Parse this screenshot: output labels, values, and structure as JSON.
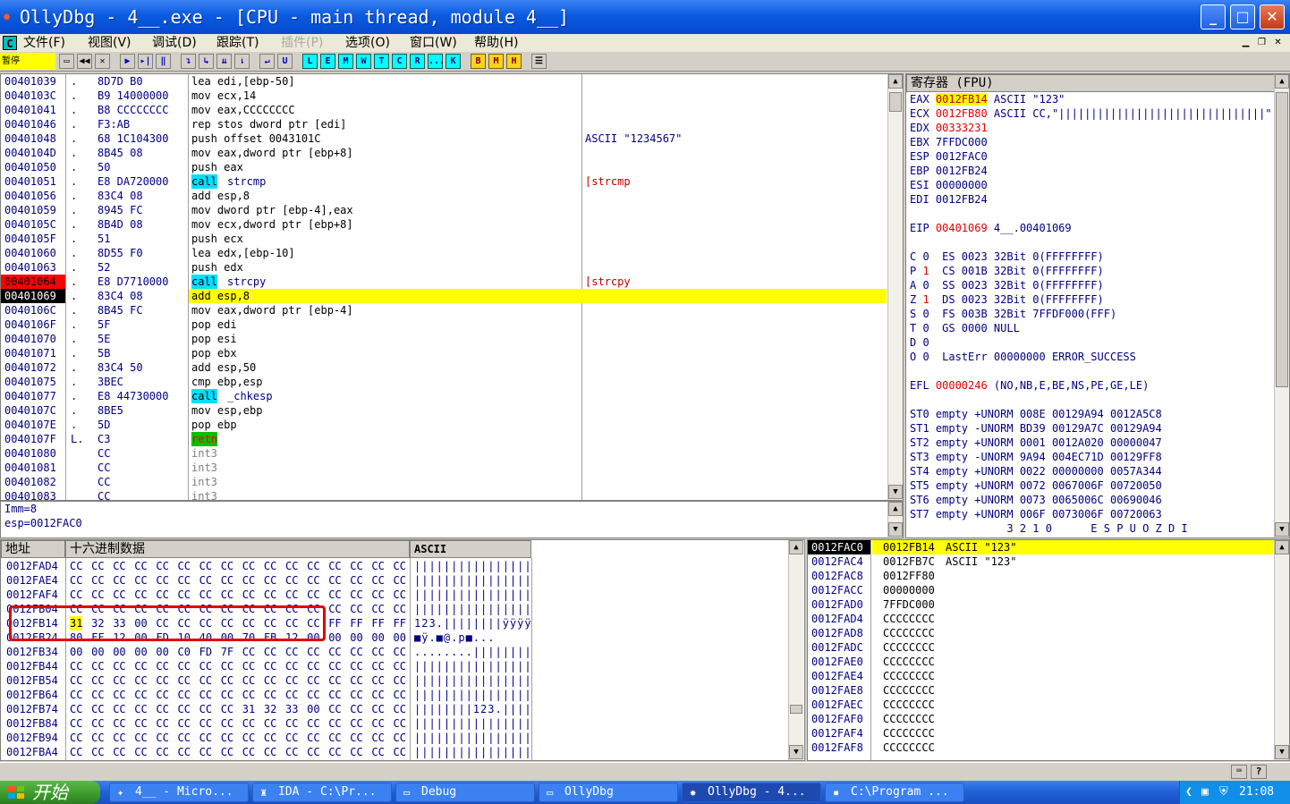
{
  "title": "OllyDbg - 4__.exe - [CPU - main thread, module 4__]",
  "window_buttons": {
    "minimize": "_",
    "maximize": "□",
    "close": "✕"
  },
  "menu": {
    "app_icon": "C",
    "items": [
      "文件(F)",
      "视图(V)",
      "调试(D)",
      "跟踪(T)",
      "插件(P)",
      "选项(O)",
      "窗口(W)",
      "帮助(H)"
    ],
    "disabled": [
      4
    ]
  },
  "status": "暂停",
  "toolbar": {
    "letters": [
      "L",
      "E",
      "M",
      "W",
      "T",
      "C",
      "R",
      "...",
      "K"
    ],
    "bmh": [
      "B",
      "M",
      "H"
    ]
  },
  "disasm": {
    "rows": [
      {
        "addr": "00401039",
        "mark": ".",
        "hex": "8D7D B0",
        "asm": "lea edi,[ebp-50]",
        "comment": ""
      },
      {
        "addr": "0040103C",
        "mark": ".",
        "hex": "B9 14000000",
        "asm": "mov ecx,14",
        "comment": ""
      },
      {
        "addr": "00401041",
        "mark": ".",
        "hex": "B8 CCCCCCCC",
        "asm": "mov eax,CCCCCCCC",
        "comment": ""
      },
      {
        "addr": "00401046",
        "mark": ".",
        "hex": "F3:AB",
        "asm": "rep stos dword ptr [edi]",
        "comment": ""
      },
      {
        "addr": "00401048",
        "mark": ".",
        "hex": "68 1C104300",
        "asm": "push offset 0043101C",
        "comment": "ASCII \"1234567\""
      },
      {
        "addr": "0040104D",
        "mark": ".",
        "hex": "8B45 08",
        "asm": "mov eax,dword ptr [ebp+8]",
        "comment": ""
      },
      {
        "addr": "00401050",
        "mark": ".",
        "hex": "50",
        "asm": "push eax",
        "comment": ""
      },
      {
        "addr": "00401051",
        "mark": ".",
        "hex": "E8 DA720000",
        "asm": "call strcmp",
        "comment": "[strcmp"
      },
      {
        "addr": "00401056",
        "mark": ".",
        "hex": "83C4 08",
        "asm": "add esp,8",
        "comment": ""
      },
      {
        "addr": "00401059",
        "mark": ".",
        "hex": "8945 FC",
        "asm": "mov dword ptr [ebp-4],eax",
        "comment": ""
      },
      {
        "addr": "0040105C",
        "mark": ".",
        "hex": "8B4D 08",
        "asm": "mov ecx,dword ptr [ebp+8]",
        "comment": ""
      },
      {
        "addr": "0040105F",
        "mark": ".",
        "hex": "51",
        "asm": "push ecx",
        "comment": ""
      },
      {
        "addr": "00401060",
        "mark": ".",
        "hex": "8D55 F0",
        "asm": "lea edx,[ebp-10]",
        "comment": ""
      },
      {
        "addr": "00401063",
        "mark": ".",
        "hex": "52",
        "asm": "push edx",
        "comment": ""
      },
      {
        "addr": "00401064",
        "mark": ".",
        "hex": "E8 D7710000",
        "asm": "call strcpy",
        "comment": "[strcpy"
      },
      {
        "addr": "00401069",
        "mark": ".",
        "hex": "83C4 08",
        "asm": "add esp,8",
        "comment": ""
      },
      {
        "addr": "0040106C",
        "mark": ".",
        "hex": "8B45 FC",
        "asm": "mov eax,dword ptr [ebp-4]",
        "comment": ""
      },
      {
        "addr": "0040106F",
        "mark": ".",
        "hex": "5F",
        "asm": "pop edi",
        "comment": ""
      },
      {
        "addr": "00401070",
        "mark": ".",
        "hex": "5E",
        "asm": "pop esi",
        "comment": ""
      },
      {
        "addr": "00401071",
        "mark": ".",
        "hex": "5B",
        "asm": "pop ebx",
        "comment": ""
      },
      {
        "addr": "00401072",
        "mark": ".",
        "hex": "83C4 50",
        "asm": "add esp,50",
        "comment": ""
      },
      {
        "addr": "00401075",
        "mark": ".",
        "hex": "3BEC",
        "asm": "cmp ebp,esp",
        "comment": ""
      },
      {
        "addr": "00401077",
        "mark": ".",
        "hex": "E8 44730000",
        "asm": "call _chkesp",
        "comment": ""
      },
      {
        "addr": "0040107C",
        "mark": ".",
        "hex": "8BE5",
        "asm": "mov esp,ebp",
        "comment": ""
      },
      {
        "addr": "0040107E",
        "mark": ".",
        "hex": "5D",
        "asm": "pop ebp",
        "comment": ""
      },
      {
        "addr": "0040107F",
        "mark": "L.",
        "hex": "C3",
        "asm": "retn",
        "comment": ""
      },
      {
        "addr": "00401080",
        "mark": "",
        "hex": "CC",
        "asm": "int3",
        "comment": ""
      },
      {
        "addr": "00401081",
        "mark": "",
        "hex": "CC",
        "asm": "int3",
        "comment": ""
      },
      {
        "addr": "00401082",
        "mark": "",
        "hex": "CC",
        "asm": "int3",
        "comment": ""
      },
      {
        "addr": "00401083",
        "mark": "",
        "hex": "CC",
        "asm": "int3",
        "comment": ""
      }
    ],
    "breakpoint_index": 14,
    "current_index": 15,
    "info": [
      "Imm=8",
      "esp=0012FAC0"
    ]
  },
  "registers": {
    "header": "寄存器 (FPU)",
    "lines": [
      [
        {
          "t": "EAX ",
          "c": "n"
        },
        {
          "t": "0012FB14",
          "c": "hl"
        },
        {
          "t": " ASCII \"123\"",
          "c": "n"
        }
      ],
      [
        {
          "t": "ECX ",
          "c": "n"
        },
        {
          "t": "0012FB80",
          "c": "r"
        },
        {
          "t": " ASCII CC,\"||||||||||||||||||||||||||||||||\"",
          "c": "n"
        }
      ],
      [
        {
          "t": "EDX ",
          "c": "n"
        },
        {
          "t": "00333231",
          "c": "r"
        }
      ],
      [
        {
          "t": "EBX 7FFDC000",
          "c": "n"
        }
      ],
      [
        {
          "t": "ESP 0012FAC0",
          "c": "n"
        }
      ],
      [
        {
          "t": "EBP 0012FB24",
          "c": "n"
        }
      ],
      [
        {
          "t": "ESI 00000000",
          "c": "n"
        }
      ],
      [
        {
          "t": "EDI 0012FB24",
          "c": "n"
        }
      ],
      [
        {
          "t": "",
          "c": "n"
        }
      ],
      [
        {
          "t": "EIP ",
          "c": "n"
        },
        {
          "t": "00401069",
          "c": "r"
        },
        {
          "t": " 4__.00401069",
          "c": "n"
        }
      ],
      [
        {
          "t": "",
          "c": "n"
        }
      ],
      [
        {
          "t": "C 0  ES 0023 32Bit 0(FFFFFFFF)",
          "c": "n"
        }
      ],
      [
        {
          "t": "P ",
          "c": "n"
        },
        {
          "t": "1",
          "c": "r"
        },
        {
          "t": "  CS 001B 32Bit 0(FFFFFFFF)",
          "c": "n"
        }
      ],
      [
        {
          "t": "A 0  SS 0023 32Bit 0(FFFFFFFF)",
          "c": "n"
        }
      ],
      [
        {
          "t": "Z ",
          "c": "n"
        },
        {
          "t": "1",
          "c": "r"
        },
        {
          "t": "  DS 0023 32Bit 0(FFFFFFFF)",
          "c": "n"
        }
      ],
      [
        {
          "t": "S 0  FS 003B 32Bit 7FFDF000(FFF)",
          "c": "n"
        }
      ],
      [
        {
          "t": "T 0  GS 0000 NULL",
          "c": "n"
        }
      ],
      [
        {
          "t": "D 0",
          "c": "n"
        }
      ],
      [
        {
          "t": "O 0  LastErr 00000000 ERROR_SUCCESS",
          "c": "n"
        }
      ],
      [
        {
          "t": "",
          "c": "n"
        }
      ],
      [
        {
          "t": "EFL ",
          "c": "n"
        },
        {
          "t": "00000246",
          "c": "r"
        },
        {
          "t": " (NO,NB,E,BE,NS,PE,GE,LE)",
          "c": "n"
        }
      ],
      [
        {
          "t": "",
          "c": "n"
        }
      ],
      [
        {
          "t": "ST0 empty +UNORM 008E 00129A94 0012A5C8",
          "c": "n"
        }
      ],
      [
        {
          "t": "ST1 empty -UNORM BD39 00129A7C 00129A94",
          "c": "n"
        }
      ],
      [
        {
          "t": "ST2 empty +UNORM 0001 0012A020 00000047",
          "c": "n"
        }
      ],
      [
        {
          "t": "ST3 empty -UNORM 9A94 004EC71D 00129FF8",
          "c": "n"
        }
      ],
      [
        {
          "t": "ST4 empty +UNORM 0022 00000000 0057A344",
          "c": "n"
        }
      ],
      [
        {
          "t": "ST5 empty +UNORM 0072 0067006F 00720050",
          "c": "n"
        }
      ],
      [
        {
          "t": "ST6 empty +UNORM 0073 0065006C 00690046",
          "c": "n"
        }
      ],
      [
        {
          "t": "ST7 empty +UNORM 006F 0073006F 00720063",
          "c": "n"
        }
      ],
      [
        {
          "t": "               3 2 1 0      E S P U O Z D I",
          "c": "n"
        }
      ],
      [
        {
          "t": "FST 0000  Cond 0 0 0 0  Err 0 0 0 0 0 0 0 0 (GT)",
          "c": "n"
        }
      ],
      [
        {
          "t": "FCW 027F  Prec NEAR,53  Mask    1 1 1 1 1 1",
          "c": "n"
        }
      ]
    ]
  },
  "dump": {
    "headers": {
      "addr": "地址",
      "hex": "十六进制数据",
      "ascii": "ASCII"
    },
    "rows": [
      {
        "addr": "0012FAD4",
        "hex": [
          "CC",
          "CC",
          "CC",
          "CC",
          "CC",
          "CC",
          "CC",
          "CC",
          "CC",
          "CC",
          "CC",
          "CC",
          "CC",
          "CC",
          "CC",
          "CC"
        ],
        "ascii": "||||||||||||||||"
      },
      {
        "addr": "0012FAE4",
        "hex": [
          "CC",
          "CC",
          "CC",
          "CC",
          "CC",
          "CC",
          "CC",
          "CC",
          "CC",
          "CC",
          "CC",
          "CC",
          "CC",
          "CC",
          "CC",
          "CC"
        ],
        "ascii": "||||||||||||||||"
      },
      {
        "addr": "0012FAF4",
        "hex": [
          "CC",
          "CC",
          "CC",
          "CC",
          "CC",
          "CC",
          "CC",
          "CC",
          "CC",
          "CC",
          "CC",
          "CC",
          "CC",
          "CC",
          "CC",
          "CC"
        ],
        "ascii": "||||||||||||||||"
      },
      {
        "addr": "0012FB04",
        "hex": [
          "CC",
          "CC",
          "CC",
          "CC",
          "CC",
          "CC",
          "CC",
          "CC",
          "CC",
          "CC",
          "CC",
          "CC",
          "CC",
          "CC",
          "CC",
          "CC"
        ],
        "ascii": "||||||||||||||||"
      },
      {
        "addr": "0012FB14",
        "hex": [
          "31",
          "32",
          "33",
          "00",
          "CC",
          "CC",
          "CC",
          "CC",
          "CC",
          "CC",
          "CC",
          "CC",
          "FF",
          "FF",
          "FF",
          "FF"
        ],
        "ascii": "123.||||||||ÿÿÿÿ"
      },
      {
        "addr": "0012FB24",
        "hex": [
          "80",
          "FF",
          "12",
          "00",
          "FD",
          "10",
          "40",
          "00",
          "70",
          "FB",
          "12",
          "00",
          "00",
          "00",
          "00",
          "00"
        ],
        "ascii": "■ÿ.■@.p■..."
      },
      {
        "addr": "0012FB34",
        "hex": [
          "00",
          "00",
          "00",
          "00",
          "00",
          "C0",
          "FD",
          "7F",
          "CC",
          "CC",
          "CC",
          "CC",
          "CC",
          "CC",
          "CC",
          "CC"
        ],
        "ascii": "........||||||||"
      },
      {
        "addr": "0012FB44",
        "hex": [
          "CC",
          "CC",
          "CC",
          "CC",
          "CC",
          "CC",
          "CC",
          "CC",
          "CC",
          "CC",
          "CC",
          "CC",
          "CC",
          "CC",
          "CC",
          "CC"
        ],
        "ascii": "||||||||||||||||"
      },
      {
        "addr": "0012FB54",
        "hex": [
          "CC",
          "CC",
          "CC",
          "CC",
          "CC",
          "CC",
          "CC",
          "CC",
          "CC",
          "CC",
          "CC",
          "CC",
          "CC",
          "CC",
          "CC",
          "CC"
        ],
        "ascii": "||||||||||||||||"
      },
      {
        "addr": "0012FB64",
        "hex": [
          "CC",
          "CC",
          "CC",
          "CC",
          "CC",
          "CC",
          "CC",
          "CC",
          "CC",
          "CC",
          "CC",
          "CC",
          "CC",
          "CC",
          "CC",
          "CC"
        ],
        "ascii": "||||||||||||||||"
      },
      {
        "addr": "0012FB74",
        "hex": [
          "CC",
          "CC",
          "CC",
          "CC",
          "CC",
          "CC",
          "CC",
          "CC",
          "31",
          "32",
          "33",
          "00",
          "CC",
          "CC",
          "CC",
          "CC"
        ],
        "ascii": "||||||||123.||||"
      },
      {
        "addr": "0012FB84",
        "hex": [
          "CC",
          "CC",
          "CC",
          "CC",
          "CC",
          "CC",
          "CC",
          "CC",
          "CC",
          "CC",
          "CC",
          "CC",
          "CC",
          "CC",
          "CC",
          "CC"
        ],
        "ascii": "||||||||||||||||"
      },
      {
        "addr": "0012FB94",
        "hex": [
          "CC",
          "CC",
          "CC",
          "CC",
          "CC",
          "CC",
          "CC",
          "CC",
          "CC",
          "CC",
          "CC",
          "CC",
          "CC",
          "CC",
          "CC",
          "CC"
        ],
        "ascii": "||||||||||||||||"
      },
      {
        "addr": "0012FBA4",
        "hex": [
          "CC",
          "CC",
          "CC",
          "CC",
          "CC",
          "CC",
          "CC",
          "CC",
          "CC",
          "CC",
          "CC",
          "CC",
          "CC",
          "CC",
          "CC",
          "CC"
        ],
        "ascii": "||||||||||||||||"
      }
    ],
    "highlight_row": 4
  },
  "stack": {
    "rows": [
      {
        "addr": "0012FAC0",
        "val": "0012FB14",
        "comment": "ASCII \"123\""
      },
      {
        "addr": "0012FAC4",
        "val": "0012FB7C",
        "comment": "ASCII \"123\""
      },
      {
        "addr": "0012FAC8",
        "val": "0012FF80",
        "comment": ""
      },
      {
        "addr": "0012FACC",
        "val": "00000000",
        "comment": ""
      },
      {
        "addr": "0012FAD0",
        "val": "7FFDC000",
        "comment": ""
      },
      {
        "addr": "0012FAD4",
        "val": "CCCCCCCC",
        "comment": ""
      },
      {
        "addr": "0012FAD8",
        "val": "CCCCCCCC",
        "comment": ""
      },
      {
        "addr": "0012FADC",
        "val": "CCCCCCCC",
        "comment": ""
      },
      {
        "addr": "0012FAE0",
        "val": "CCCCCCCC",
        "comment": ""
      },
      {
        "addr": "0012FAE4",
        "val": "CCCCCCCC",
        "comment": ""
      },
      {
        "addr": "0012FAE8",
        "val": "CCCCCCCC",
        "comment": ""
      },
      {
        "addr": "0012FAEC",
        "val": "CCCCCCCC",
        "comment": ""
      },
      {
        "addr": "0012FAF0",
        "val": "CCCCCCCC",
        "comment": ""
      },
      {
        "addr": "0012FAF4",
        "val": "CCCCCCCC",
        "comment": ""
      },
      {
        "addr": "0012FAF8",
        "val": "CCCCCCCC",
        "comment": ""
      }
    ]
  },
  "taskbar": {
    "start": "开始",
    "tasks": [
      "4__ - Micro...",
      "IDA - C:\\Pr...",
      "Debug",
      "OllyDbg",
      "OllyDbg - 4...",
      "C:\\Program ..."
    ],
    "active_index": 4,
    "clock": "21:08"
  },
  "colors": {
    "highlight_yellow": "#ffff00",
    "call_cyan": "#00e0ff",
    "breakpoint_red": "#ff0000",
    "annotation_red": "#e00000",
    "text_navy": "#000080"
  }
}
